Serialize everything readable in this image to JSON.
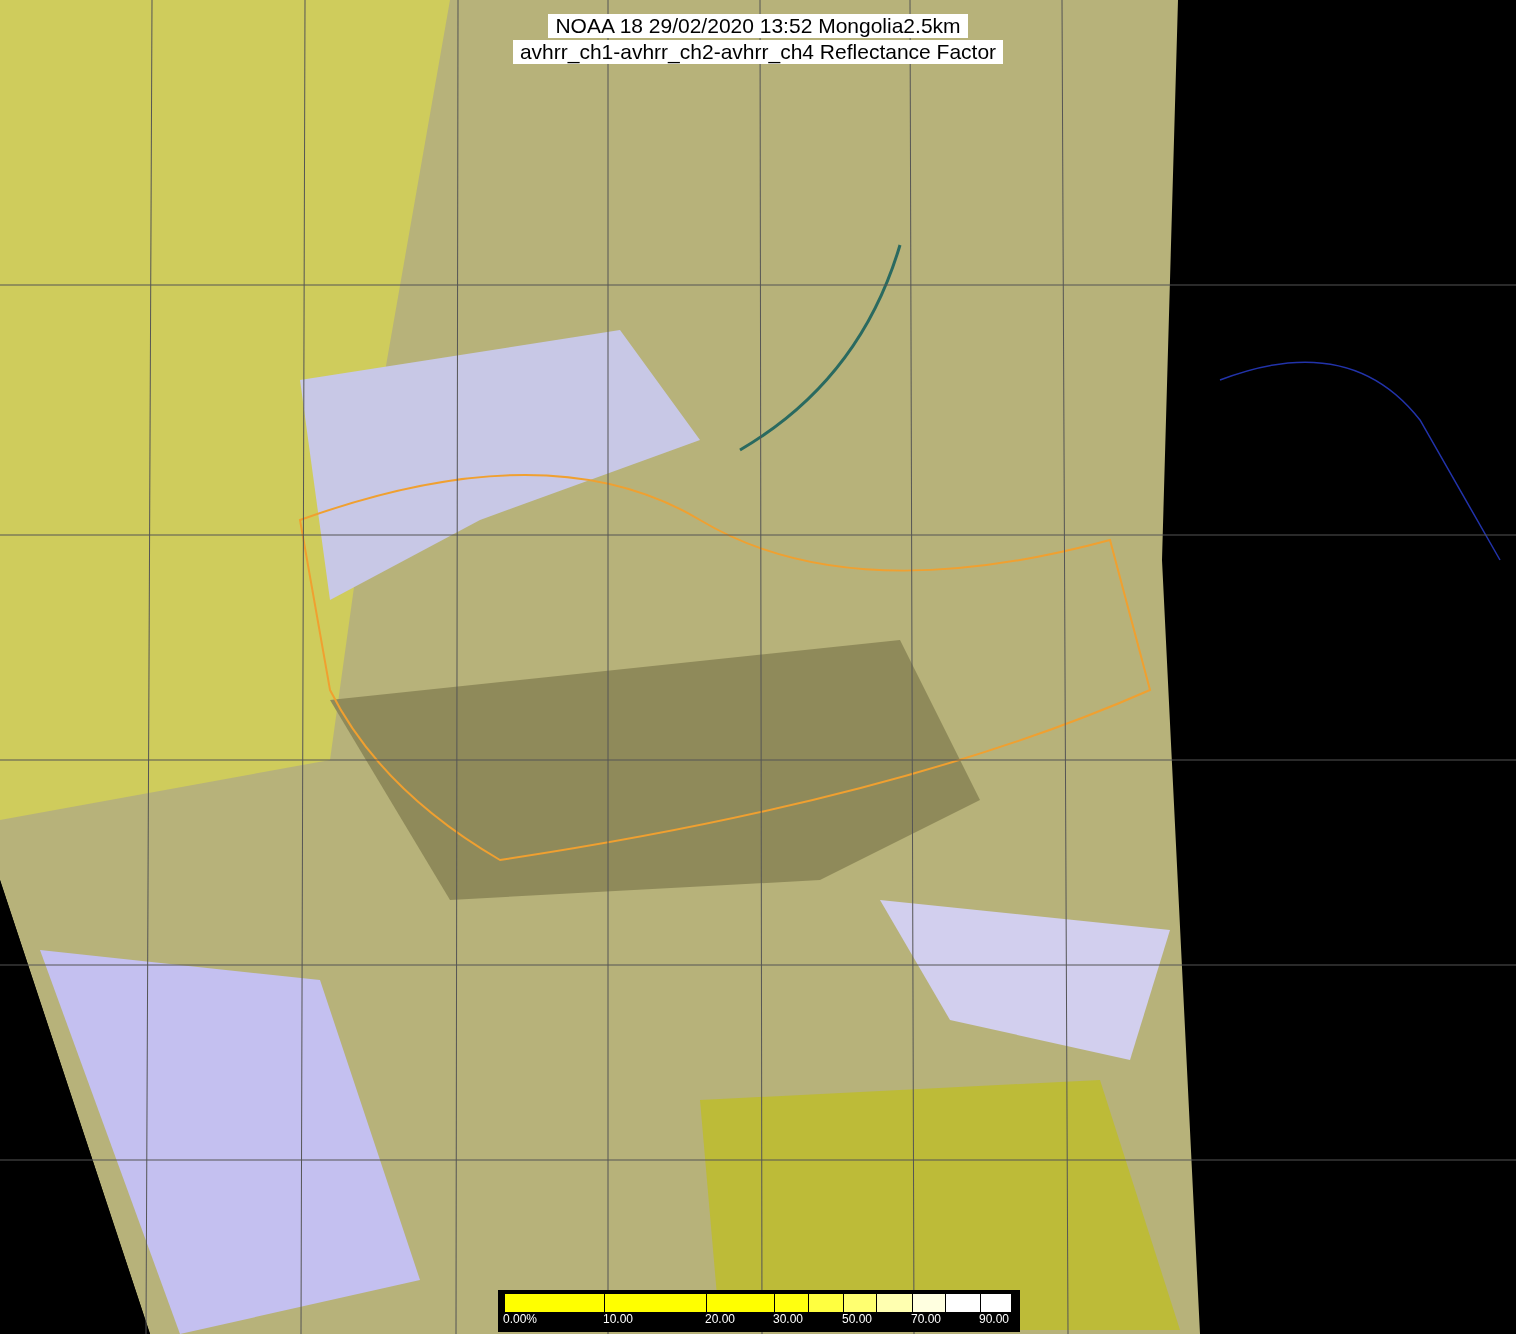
{
  "title": {
    "lines": [
      "NOAA 18 29/02/2020 13:52 Mongolia2.5km",
      "avhrr_ch1-avhrr_ch2-avhrr_ch4 Reflectance Factor"
    ]
  },
  "colorbar": {
    "segments": [
      {
        "color": "#ffff00",
        "label": "0.00%"
      },
      {
        "color": "#ffff00",
        "label": "10.00"
      },
      {
        "color": "#ffff00",
        "label": "20.00"
      },
      {
        "color": "#ffff10",
        "label": "30.00"
      },
      {
        "color": "#ffff40"
      },
      {
        "color": "#ffff70",
        "label": "50.00"
      },
      {
        "color": "#ffffb0"
      },
      {
        "color": "#ffffe0",
        "label": "70.00"
      },
      {
        "color": "#ffffff"
      },
      {
        "color": "#ffffff",
        "label": "90.00"
      }
    ]
  }
}
